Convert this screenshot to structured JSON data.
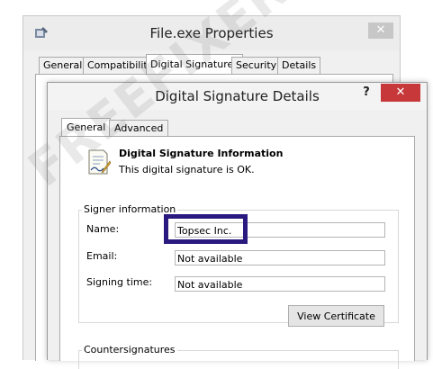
{
  "outer_window": {
    "title": "File.exe Properties",
    "close_glyph": "✕",
    "tabs": [
      {
        "label": "General"
      },
      {
        "label": "Compatibility"
      },
      {
        "label": "Digital Signatures",
        "active": true
      },
      {
        "label": "Security"
      },
      {
        "label": "Details"
      }
    ]
  },
  "dialog": {
    "title": "Digital Signature Details",
    "help_glyph": "?",
    "close_glyph": "✕",
    "tabs": [
      {
        "label": "General",
        "active": true
      },
      {
        "label": "Advanced"
      }
    ],
    "info_heading": "Digital Signature Information",
    "info_status": "This digital signature is OK.",
    "signer_group_label": "Signer information",
    "fields": {
      "name_label": "Name:",
      "name_value": "Topsec Inc.",
      "email_label": "Email:",
      "email_value": "Not available",
      "signing_time_label": "Signing time:",
      "signing_time_value": "Not available"
    },
    "view_certificate_label": "View Certificate",
    "countersignatures_label": "Countersignatures"
  },
  "highlight_color": "#2a1a80",
  "close_button_color": "#c7383a",
  "watermark_text": "FREEFIXER"
}
